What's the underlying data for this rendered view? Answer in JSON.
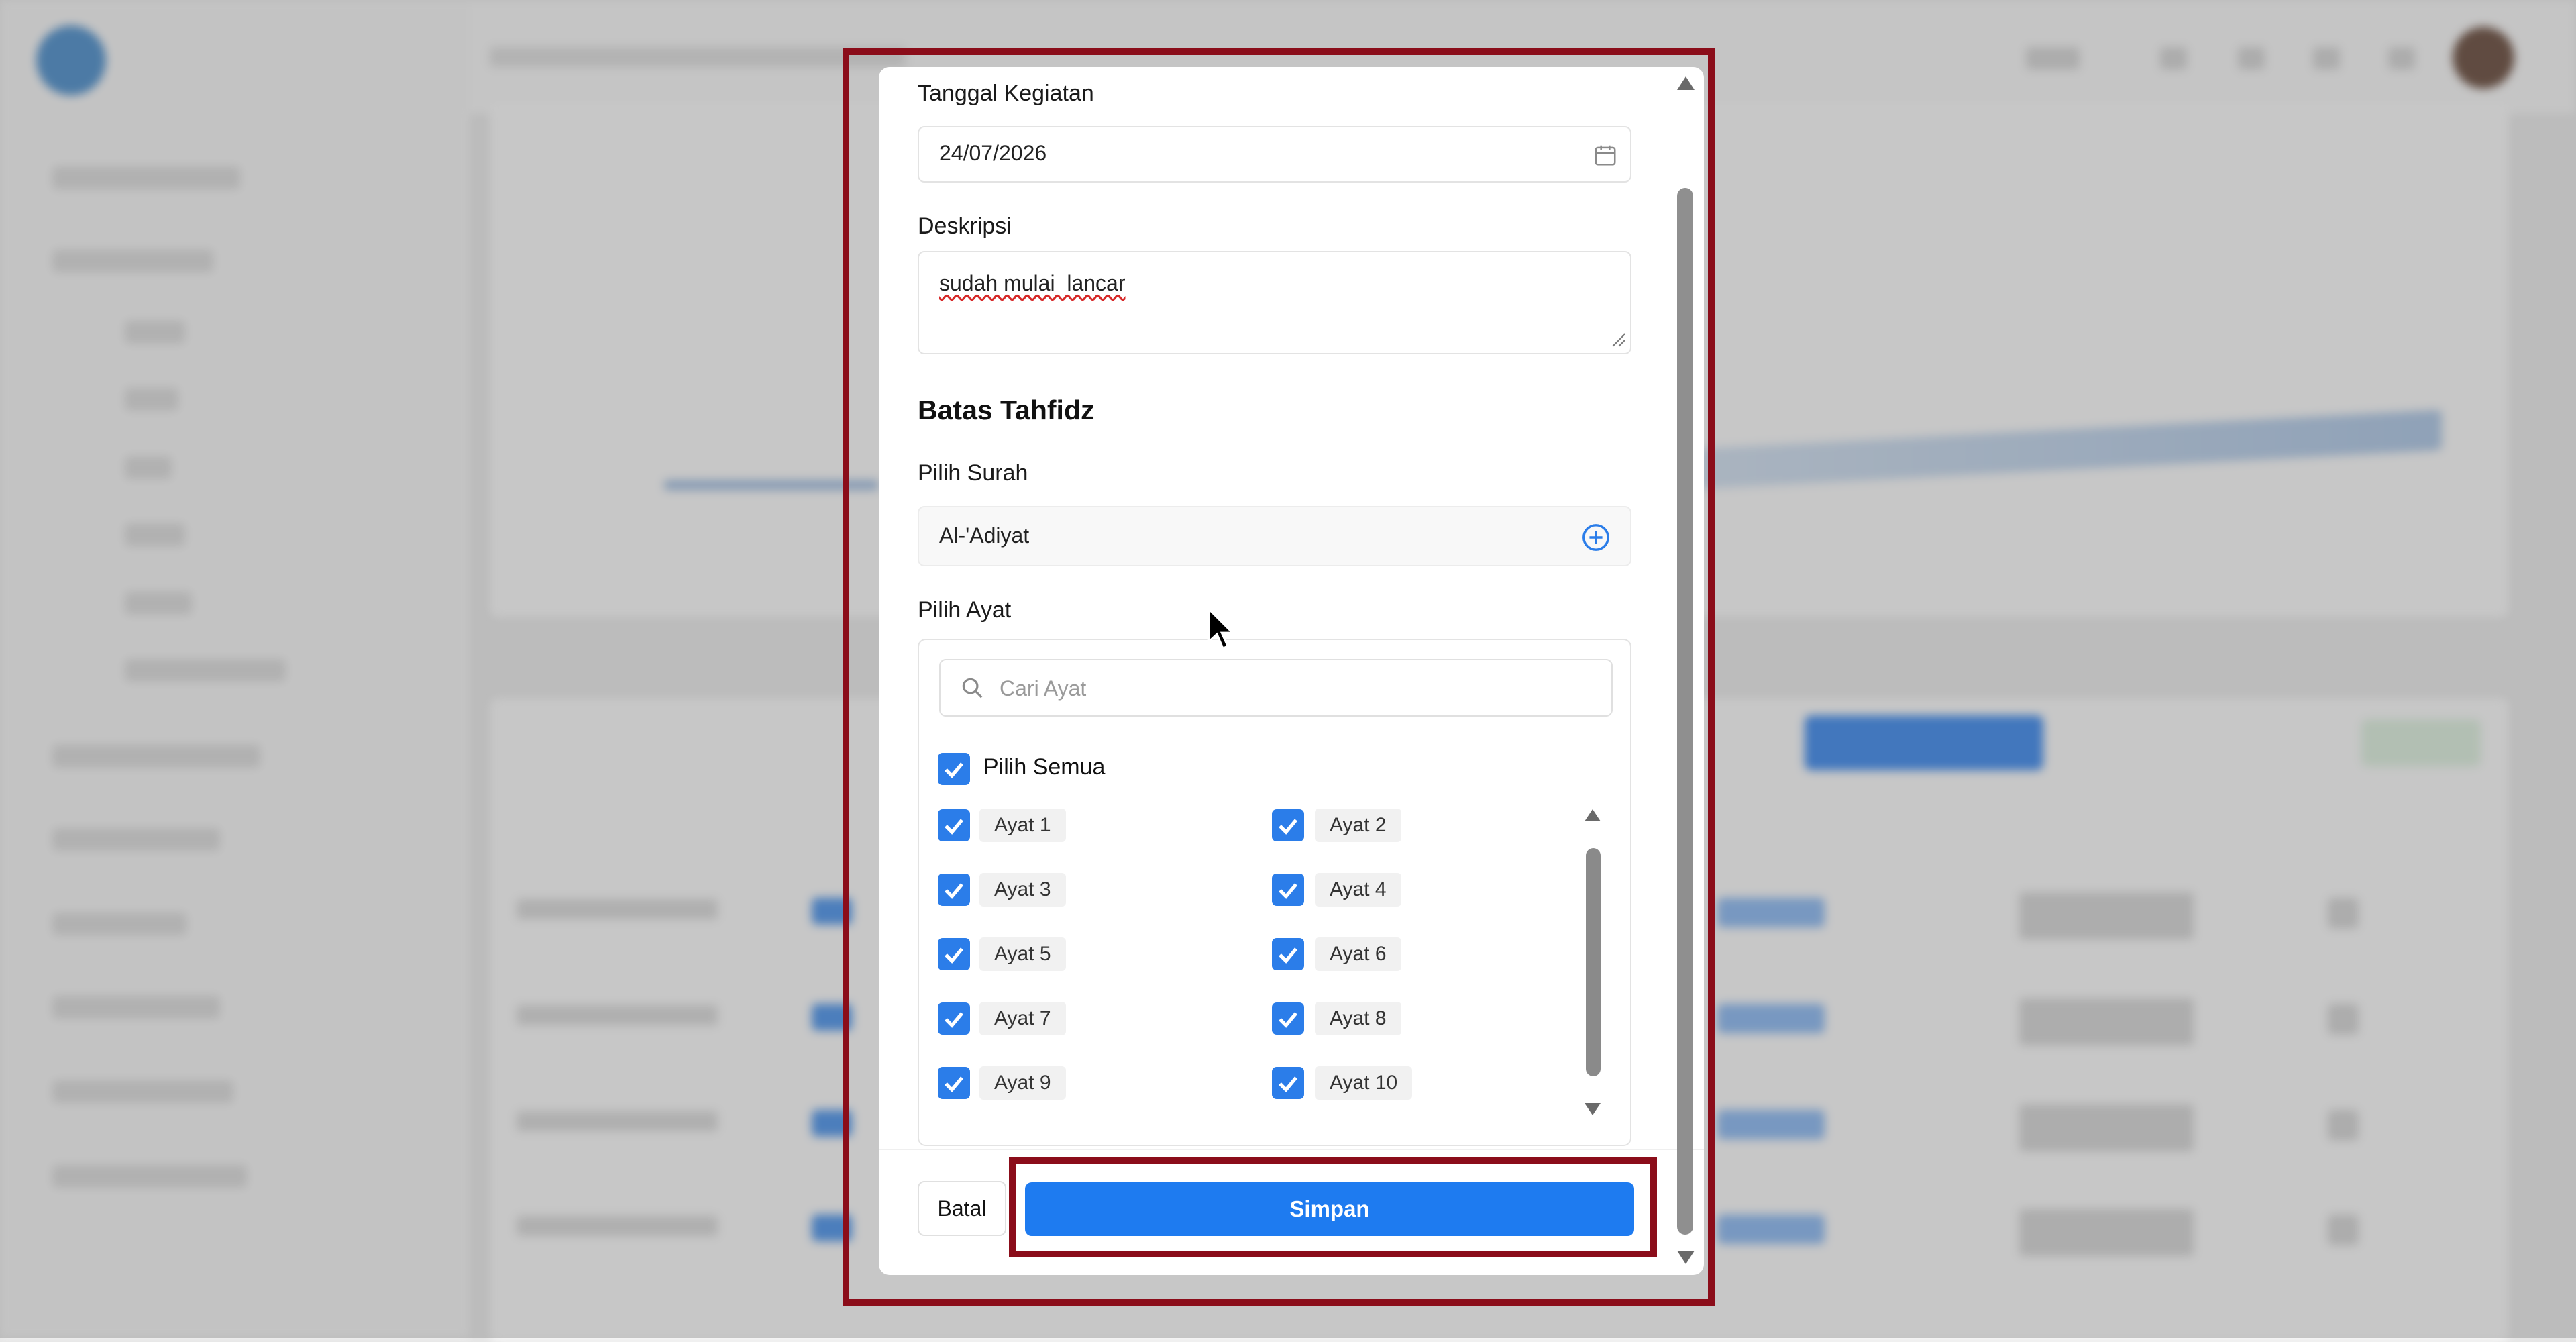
{
  "form": {
    "tanggal_label": "Tanggal Kegiatan",
    "tanggal_value": "24/07/2026",
    "deskripsi_label": "Deskripsi",
    "deskripsi_value": "sudah mulai  lancar",
    "section_title": "Batas Tahfidz",
    "surah_label": "Pilih Surah",
    "surah_value": "Al-'Adiyat",
    "ayat_label": "Pilih Ayat",
    "search_placeholder": "Cari Ayat",
    "pilih_semua": "Pilih Semua",
    "ayat": [
      {
        "label": "Ayat 1",
        "checked": true
      },
      {
        "label": "Ayat 2",
        "checked": true
      },
      {
        "label": "Ayat 3",
        "checked": true
      },
      {
        "label": "Ayat 4",
        "checked": true
      },
      {
        "label": "Ayat 5",
        "checked": true
      },
      {
        "label": "Ayat 6",
        "checked": true
      },
      {
        "label": "Ayat 7",
        "checked": true
      },
      {
        "label": "Ayat 8",
        "checked": true
      },
      {
        "label": "Ayat 9",
        "checked": true
      },
      {
        "label": "Ayat 10",
        "checked": true
      }
    ]
  },
  "buttons": {
    "batal": "Batal",
    "simpan": "Simpan"
  },
  "colors": {
    "primary": "#1e7bf0",
    "highlight": "#8b0d1a",
    "checkbox": "#2b7de9"
  },
  "icons": {
    "calendar": "calendar-icon",
    "add": "plus-circle-icon",
    "search": "search-icon",
    "check": "check-icon",
    "resize": "resize-handle-icon",
    "cursor": "mouse-pointer-icon"
  }
}
